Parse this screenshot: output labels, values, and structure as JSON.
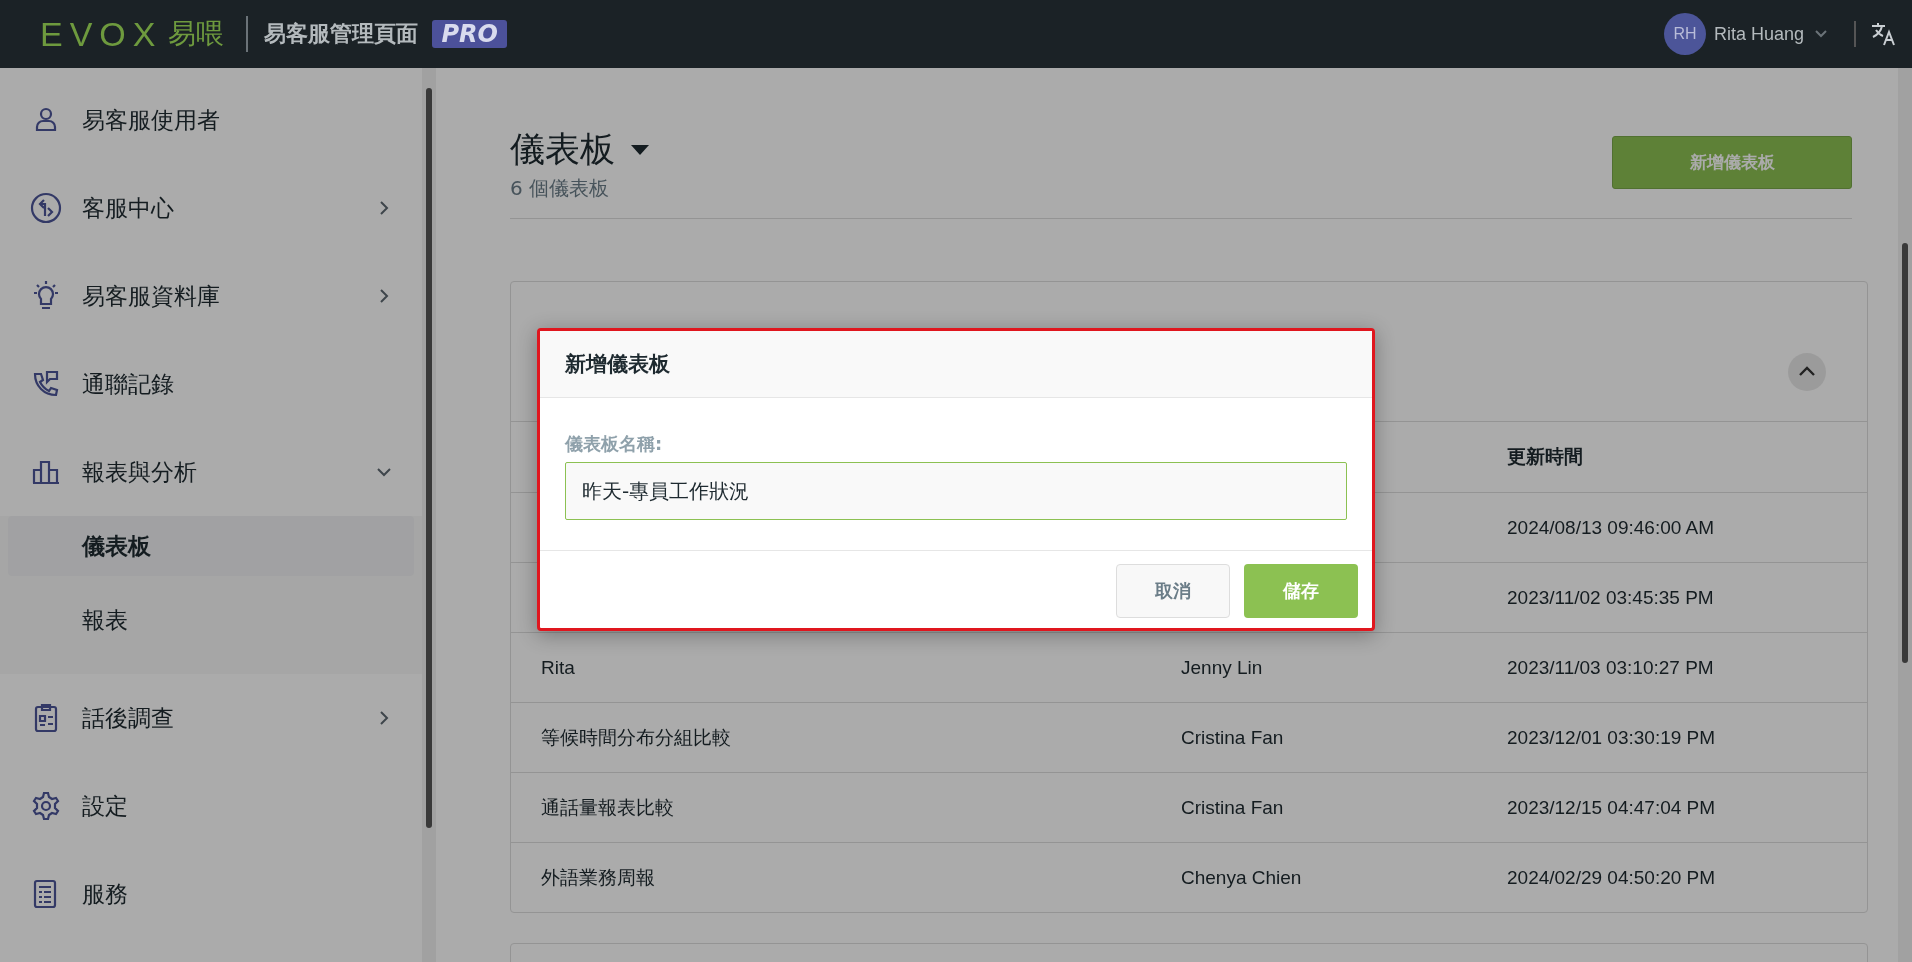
{
  "header": {
    "logo": "EVOX",
    "logo_cn": "易喂",
    "title": "易客服管理頁面",
    "badge": "PRO",
    "user_initials": "RH",
    "user_name": "Rita Huang"
  },
  "sidebar": {
    "items": [
      {
        "label": "易客服使用者"
      },
      {
        "label": "客服中心",
        "expanded": false
      },
      {
        "label": "易客服資料庫",
        "expanded": false
      },
      {
        "label": "通聯記錄"
      },
      {
        "label": "報表與分析",
        "expanded": true,
        "children": [
          {
            "label": "儀表板",
            "selected": true
          },
          {
            "label": "報表",
            "selected": false
          }
        ]
      },
      {
        "label": "話後調查",
        "expanded": false
      },
      {
        "label": "設定"
      },
      {
        "label": "服務"
      }
    ]
  },
  "page": {
    "title": "儀表板",
    "count": "6 個儀表板",
    "new_button": "新增儀表板"
  },
  "card": {
    "expanded": true,
    "columns": [
      "更新時間"
    ],
    "rows": [
      {
        "updated": "2024/08/13 09:46:00 AM"
      },
      {
        "updated": "2023/11/02 03:45:35 PM"
      },
      {
        "name": "Rita",
        "owner": "Jenny Lin",
        "updated": "2023/11/03 03:10:27 PM"
      },
      {
        "name": "等候時間分布分組比較",
        "owner": "Cristina Fan",
        "updated": "2023/12/01 03:30:19 PM"
      },
      {
        "name": "通話量報表比較",
        "owner": "Cristina Fan",
        "updated": "2023/12/15 04:47:04 PM"
      },
      {
        "name": "外語業務周報",
        "owner": "Chenya Chien",
        "updated": "2024/02/29 04:50:20 PM"
      }
    ]
  },
  "dialog": {
    "title": "新增儀表板",
    "field_label": "儀表板名稱:",
    "value": "昨天-專員工作狀況",
    "cancel": "取消",
    "save": "儲存"
  }
}
